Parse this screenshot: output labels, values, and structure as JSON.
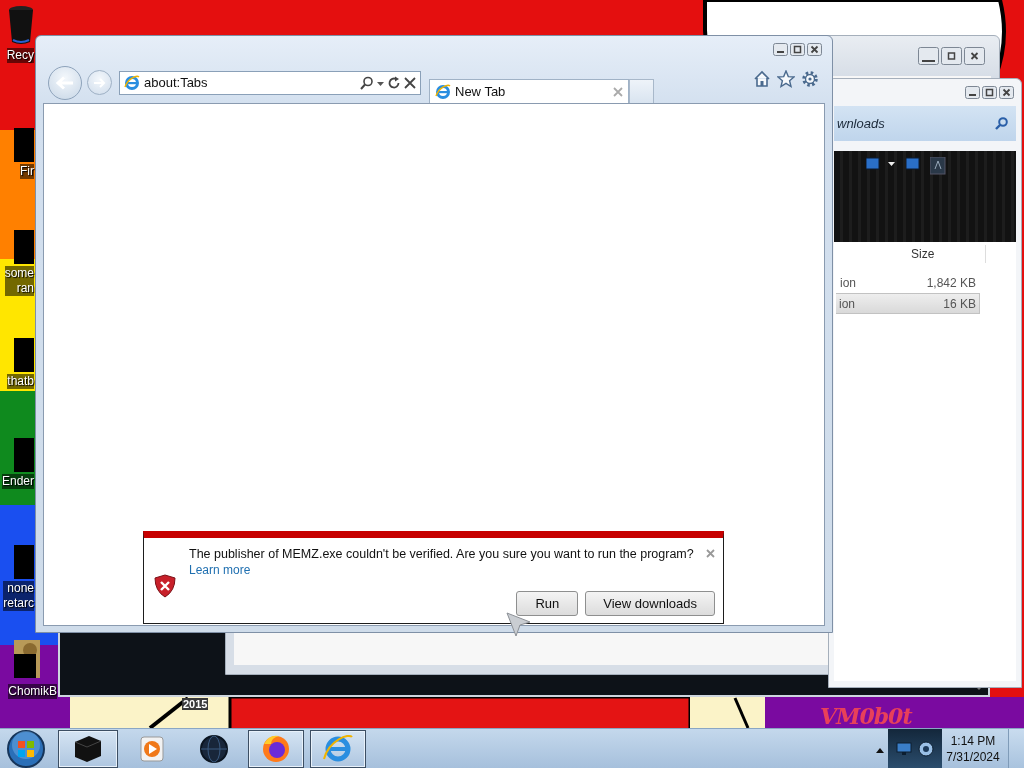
{
  "desktop_icons": [
    {
      "label": "Recy"
    },
    {
      "label": "Fir"
    },
    {
      "label": "some\nran"
    },
    {
      "label": "thatb"
    },
    {
      "label": "Ender"
    },
    {
      "label": "none\nretarc"
    },
    {
      "label": "ChomikB"
    }
  ],
  "wallpaper_texts": [
    "2015",
    "VM0b0t"
  ],
  "explorer": {
    "address": "wnloads",
    "columns": [
      "Size"
    ],
    "rows": [
      {
        "column_1": "ion",
        "size": "1,842 KB",
        "selected": false
      },
      {
        "column_1": "ion",
        "size": "16 KB",
        "selected": true
      }
    ]
  },
  "browser": {
    "address": "about:Tabs",
    "tabs": [
      {
        "label": "New Tab",
        "selected": true
      }
    ],
    "notification": {
      "message": "The publisher of MEMZ.exe couldn't be verified. Are you sure you want to run the program?",
      "link": "Learn more",
      "buttons": [
        "Run",
        "View downloads"
      ]
    }
  },
  "taskbar": {
    "buttons": [
      {
        "kind": "box",
        "active": true
      },
      {
        "kind": "media",
        "active": false
      },
      {
        "kind": "globe",
        "active": false
      },
      {
        "kind": "firefox",
        "active": true
      },
      {
        "kind": "ie",
        "active": true
      }
    ],
    "clock": {
      "time": "1:14 PM",
      "date": "7/31/2024"
    }
  }
}
